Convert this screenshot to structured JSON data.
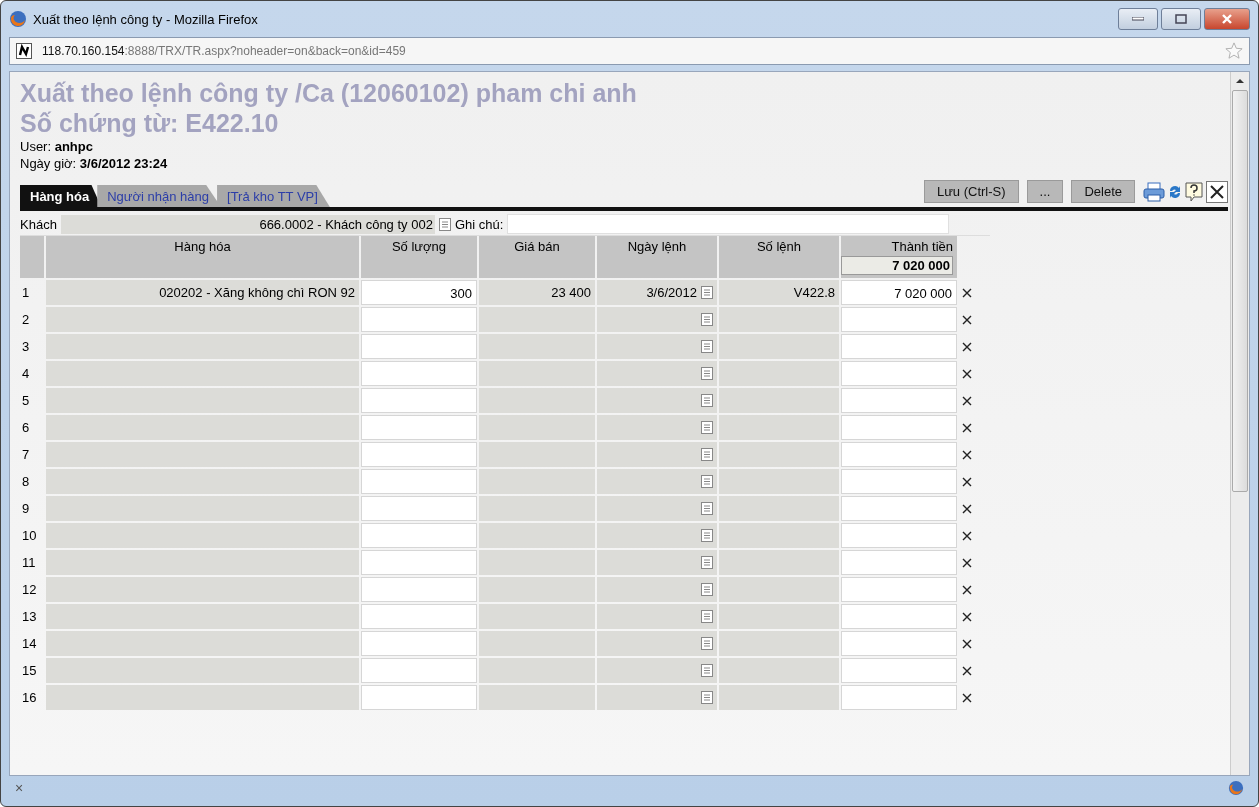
{
  "window": {
    "title": "Xuất theo lệnh công ty - Mozilla Firefox"
  },
  "address_bar": {
    "host": "118.70.160.154",
    "path": ":8888/TRX/TR.aspx?noheader=on&back=on&id=459"
  },
  "page": {
    "title": "Xuất theo lệnh công ty /Ca (12060102) pham chi anh",
    "voucher": "Số chứng từ: E422.10",
    "user_label": "User:",
    "user": "anhpc",
    "date_label": "Ngày giờ:",
    "date": "3/6/2012 23:24"
  },
  "tabs": [
    {
      "label": "Hàng hóa",
      "selected": true
    },
    {
      "label": "Người nhận hàng",
      "selected": false
    },
    {
      "label": "[Trả kho TT VP]",
      "selected": false
    }
  ],
  "toolbar": {
    "buttons": [
      "Lưu (Ctrl-S)",
      "...",
      "Delete"
    ]
  },
  "form": {
    "customer_label": "Khách",
    "customer": "666.0002 - Khách công ty 002",
    "note_label": "Ghi chú:"
  },
  "table": {
    "columns": [
      "Hàng hóa",
      "Số lượng",
      "Giá bán",
      "Ngày lệnh",
      "Số lệnh",
      "Thành tiền"
    ],
    "total": "7 020 000",
    "rows": [
      {
        "number": "1",
        "product": "020202 - Xăng không chì RON 92",
        "quantity": "300",
        "price": "23 400",
        "order_date": "3/6/2012",
        "order_no": "V422.8",
        "amount": "7 020 000"
      },
      {
        "number": "2"
      },
      {
        "number": "3"
      },
      {
        "number": "4"
      },
      {
        "number": "5"
      },
      {
        "number": "6"
      },
      {
        "number": "7"
      },
      {
        "number": "8"
      },
      {
        "number": "9"
      },
      {
        "number": "10"
      },
      {
        "number": "11"
      },
      {
        "number": "12"
      },
      {
        "number": "13"
      },
      {
        "number": "14"
      },
      {
        "number": "15"
      },
      {
        "number": "16"
      }
    ]
  },
  "status_bar": {
    "close_glyph": "×"
  }
}
